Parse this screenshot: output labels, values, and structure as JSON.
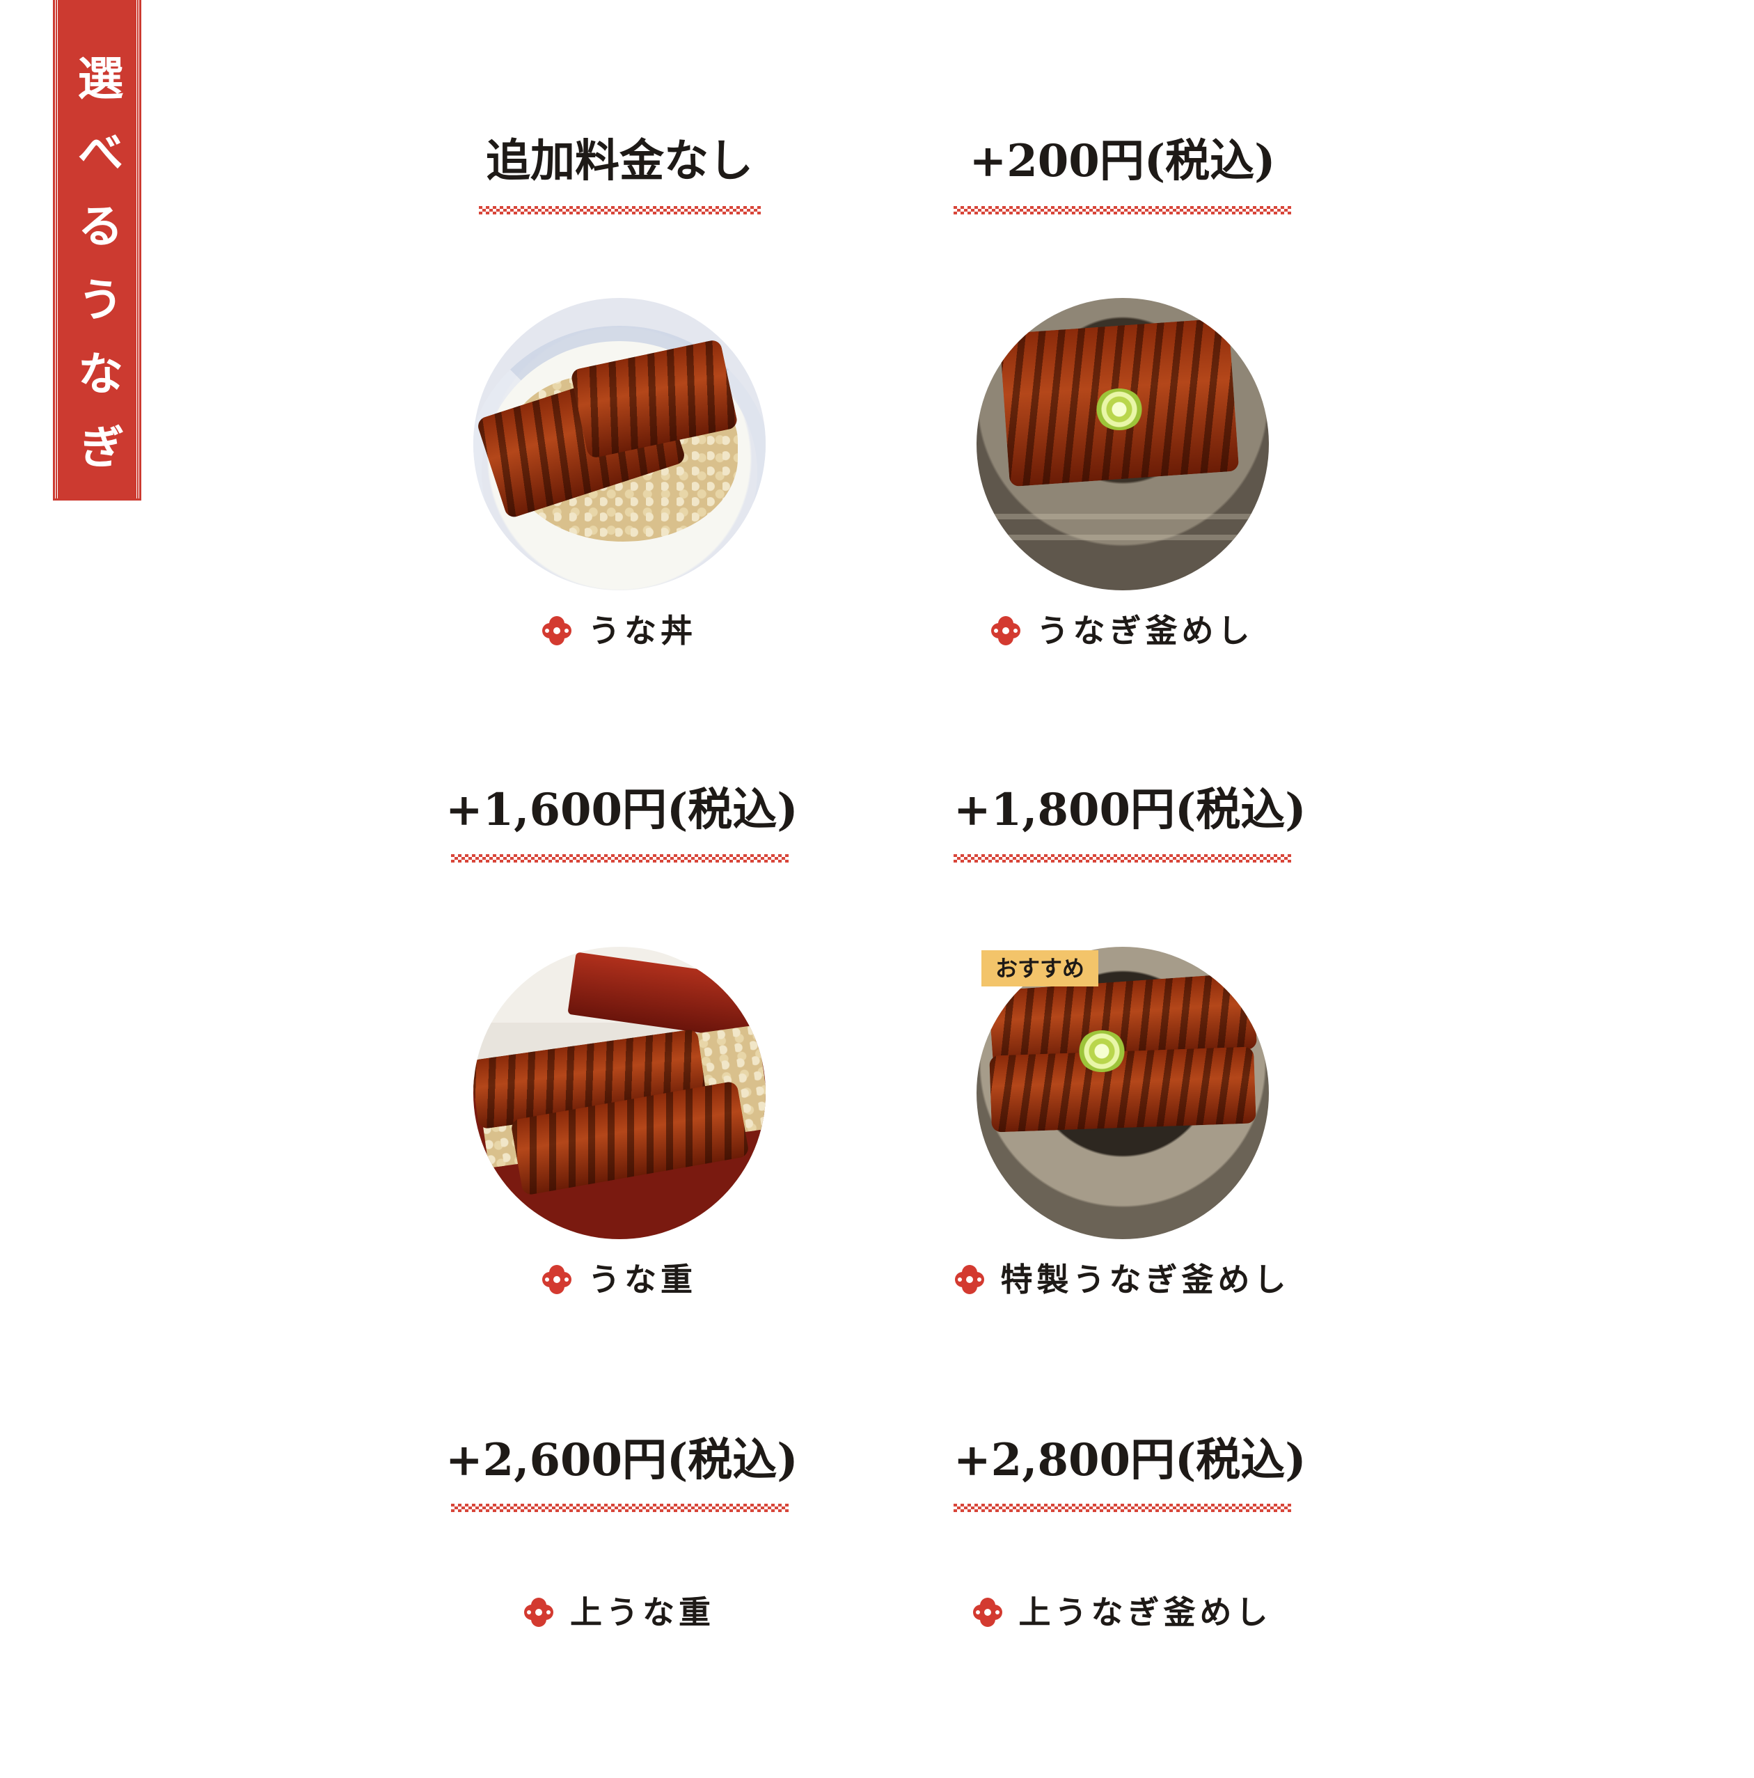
{
  "banner": {
    "title": "選べるうなぎ"
  },
  "colors": {
    "accent": "#cc3a30",
    "badge": "#f3c46a"
  },
  "options": [
    {
      "price": "追加料金なし",
      "dish": "うな丼",
      "photo_icon": "unadon-photo"
    },
    {
      "price": "+200円(税込)",
      "dish": "うなぎ釜めし",
      "photo_icon": "unagi-kamameshi-photo"
    },
    {
      "price": "+1,600円(税込)",
      "dish": "うな重",
      "photo_icon": "unaju-photo"
    },
    {
      "price": "+1,800円(税込)",
      "dish": "特製うなぎ釜めし",
      "photo_icon": "special-kamameshi-photo",
      "badge": "おすすめ"
    },
    {
      "price": "+2,600円(税込)",
      "dish": "上うな重"
    },
    {
      "price": "+2,800円(税込)",
      "dish": "上うなぎ釜めし"
    }
  ]
}
